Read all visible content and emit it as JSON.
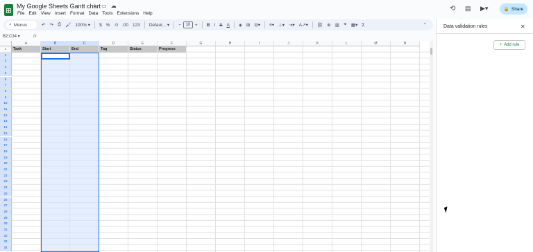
{
  "app": {
    "doc_title": "My Google Sheets Gantt chart",
    "share_label": "Share"
  },
  "menubar": {
    "items": [
      "File",
      "Edit",
      "View",
      "Insert",
      "Format",
      "Data",
      "Tools",
      "Extensions",
      "Help"
    ]
  },
  "toolbar": {
    "menus_label": "Menus",
    "zoom": "100%",
    "currency": "$",
    "percent": "%",
    "decrease_decimal": ".0",
    "increase_decimal": ".00",
    "number_format": "123",
    "font_family": "Defaul...",
    "font_size": "10"
  },
  "formula_bar": {
    "name_box": "B2:C34",
    "fx": "fx"
  },
  "grid": {
    "columns": [
      "A",
      "B",
      "C",
      "D",
      "E",
      "F",
      "G",
      "H",
      "I",
      "J",
      "K",
      "L",
      "M",
      "N"
    ],
    "selected_columns": [
      "B",
      "C"
    ],
    "rows": [
      "1",
      "2",
      "3",
      "4",
      "5",
      "6",
      "7",
      "8",
      "9",
      "10",
      "11",
      "12",
      "13",
      "14",
      "15",
      "16",
      "17",
      "18",
      "19",
      "20",
      "21",
      "22",
      "23",
      "24",
      "25",
      "26",
      "27",
      "28",
      "29",
      "30",
      "31",
      "32",
      "33",
      "34"
    ],
    "header_values": [
      "Task",
      "Start",
      "End",
      "Tag",
      "Status",
      "Progress"
    ]
  },
  "side_panel": {
    "title": "Data validation rules",
    "add_rule_label": "Add rule"
  },
  "colors": {
    "accent": "#1a73e8",
    "selection_fill": "#d3e3fd",
    "share_bg": "#c2e7ff",
    "sheets_green": "#188038",
    "header_row_bg": "#c7c7c7"
  }
}
